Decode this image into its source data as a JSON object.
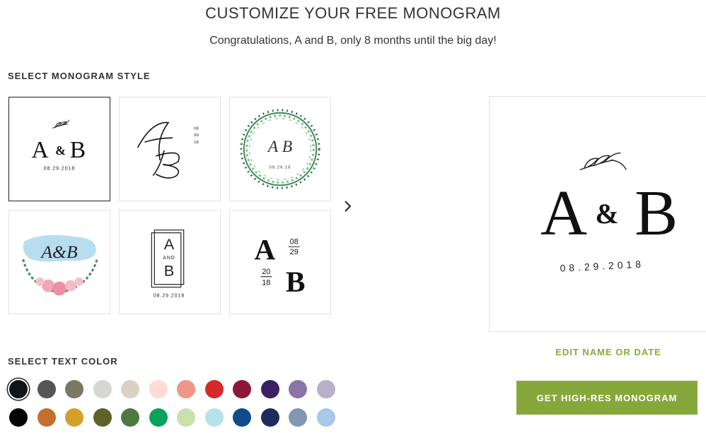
{
  "header": {
    "title": "CUSTOMIZE YOUR FREE MONOGRAM",
    "subtitle": "Congratulations, A and B, only 8 months until the big day!"
  },
  "style_section": {
    "label": "SELECT MONOGRAM STYLE",
    "styles": [
      {
        "id": "leaf-classic",
        "selected": true,
        "initials": "A & B",
        "date": "08.29.2018",
        "icon": "leaf-sprig-icon"
      },
      {
        "id": "script-vertical",
        "selected": false,
        "initials": "A B",
        "date_lines": [
          "08",
          "09",
          "18"
        ]
      },
      {
        "id": "green-wreath",
        "selected": false,
        "initials": "A B",
        "date": "08.29.18",
        "icon": "leaf-wreath-icon"
      },
      {
        "id": "watercolor-floral",
        "selected": false,
        "initials": "A&B",
        "icon": "floral-wreath-icon"
      },
      {
        "id": "framed-and",
        "selected": false,
        "initials_top": "A",
        "and": "AND",
        "initials_bottom": "B",
        "date": "08.29.2018"
      },
      {
        "id": "bold-split-date",
        "selected": false,
        "initial_a": "A",
        "initial_b": "B",
        "date_parts": [
          "08",
          "29",
          "20",
          "18"
        ]
      }
    ],
    "next_icon": "chevron-right-icon"
  },
  "preview": {
    "initial_a": "A",
    "ampersand": "&",
    "initial_b": "B",
    "date": "08.29.2018",
    "icon": "leaf-sprig-icon"
  },
  "edit_link": "EDIT NAME OR DATE",
  "cta": "GET HIGH-RES MONOGRAM",
  "color_section": {
    "label": "SELECT TEXT COLOR",
    "selected_index": 0,
    "row1": [
      "#111418",
      "#555555",
      "#7a7763",
      "#d6d6d2",
      "#dcd0c3",
      "#fcdcd5",
      "#ee9687",
      "#d32a2a",
      "#8c1838",
      "#3b2065",
      "#8b74a6",
      "#b8b0c6"
    ],
    "row2": [
      "#050505",
      "#c4702c",
      "#d4a02a",
      "#5d6328",
      "#4e7a42",
      "#0aa25b",
      "#c8e1ad",
      "#b5e3e8",
      "#0f4c8a",
      "#1e2b5e",
      "#7f97b2",
      "#a8c8e8"
    ]
  }
}
